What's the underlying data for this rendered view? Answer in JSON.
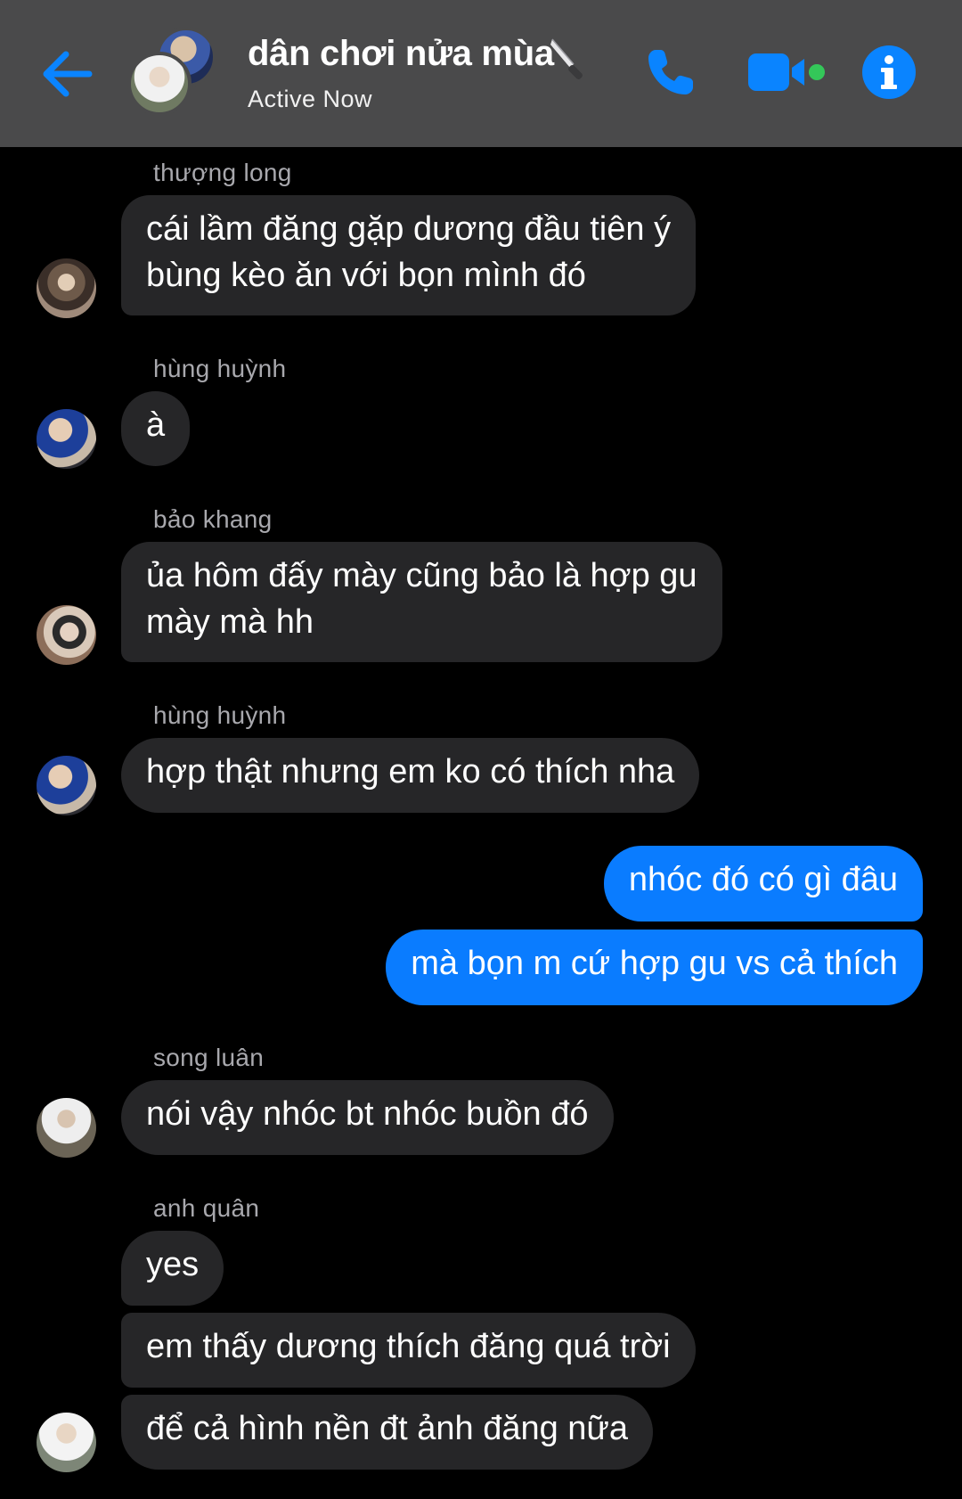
{
  "header": {
    "title": "dân chơi nửa mùa",
    "status": "Active Now",
    "icons": {
      "back": "back-arrow-icon",
      "title_emoji": "knife-icon",
      "call": "phone-icon",
      "video": "video-camera-icon",
      "info": "info-icon"
    },
    "accent_color": "#0a84ff",
    "online_color": "#34c759"
  },
  "messages": [
    {
      "sender": "thượng long",
      "lines": [
        "cái lầm đăng gặp dương đầu tiên ý",
        "bùng kèo ăn với bọn mình đó"
      ]
    },
    {
      "sender": "hùng huỳnh",
      "lines": [
        "à"
      ]
    },
    {
      "sender": "bảo khang",
      "lines": [
        "ủa hôm đấy mày cũng bảo là hợp gu",
        "mày mà hh"
      ]
    },
    {
      "sender": "hùng huỳnh",
      "lines": [
        "hợp thật nhưng em ko có thích nha"
      ]
    },
    {
      "sender": "me",
      "lines": [
        "nhóc đó có gì đâu"
      ]
    },
    {
      "sender": "me",
      "lines": [
        "mà bọn m cứ hợp gu vs cả thích"
      ]
    },
    {
      "sender": "song luân",
      "lines": [
        "nói vậy nhóc bt nhóc buồn đó"
      ]
    },
    {
      "sender": "anh quân",
      "lines": [
        "yes"
      ]
    },
    {
      "sender": "anh quân",
      "lines": [
        "em thấy dương thích đăng quá trời"
      ]
    },
    {
      "sender": "anh quân",
      "lines": [
        "để cả hình nền đt ảnh đăng nữa"
      ]
    }
  ],
  "colors": {
    "incoming_bubble": "#262628",
    "outgoing_bubble": "#0a7cff",
    "sender_name": "#a8a8ad"
  }
}
